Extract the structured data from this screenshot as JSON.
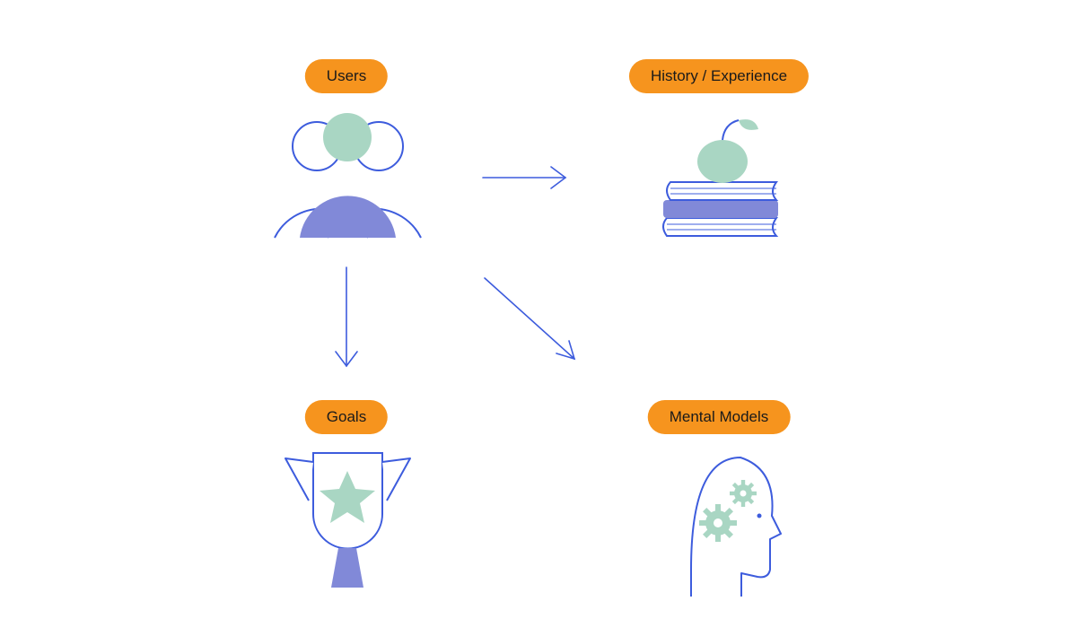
{
  "diagram": {
    "nodes": {
      "users": {
        "label": "Users"
      },
      "history": {
        "label": "History / Experience"
      },
      "goals": {
        "label": "Goals"
      },
      "mental": {
        "label": "Mental Models"
      }
    },
    "arrows": [
      {
        "from": "users",
        "to": "history"
      },
      {
        "from": "users",
        "to": "goals"
      },
      {
        "from": "users",
        "to": "mental"
      }
    ],
    "colors": {
      "pill": "#f6941e",
      "stroke": "#3d5cdd",
      "fillA": "#a9d6c3",
      "fillB": "#8189d8"
    }
  }
}
